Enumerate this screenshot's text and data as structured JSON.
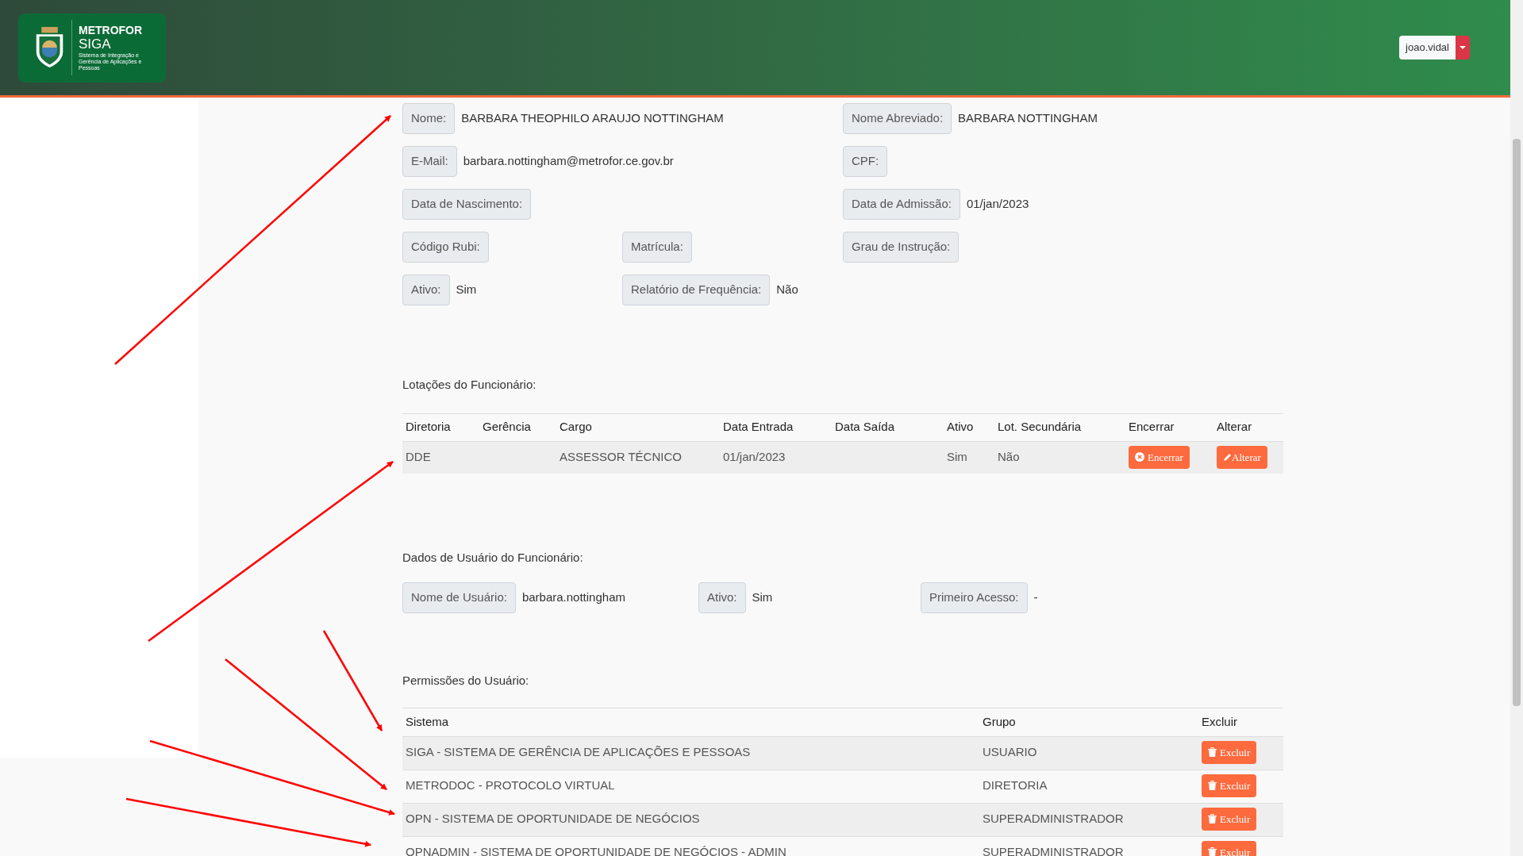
{
  "header": {
    "logo": {
      "brand": "METROFOR",
      "product": "SIGA",
      "tagline": "Sistema de Integração e Gerência de Aplicações e Pessoas"
    },
    "user": {
      "name": "joao.vidal"
    }
  },
  "employee_fields": [
    {
      "left": {
        "label": "Nome:",
        "value": "BARBARA THEOPHILO ARAUJO NOTTINGHAM"
      },
      "right": {
        "label": "Nome Abreviado:",
        "value": "BARBARA NOTTINGHAM"
      }
    },
    {
      "left": {
        "label": "E-Mail:",
        "value": "barbara.nottingham@metrofor.ce.gov.br"
      },
      "right": {
        "label": "CPF:"
      }
    },
    {
      "left": {
        "label": "Data de Nascimento:"
      },
      "right": {
        "label": "Data de Admissão:",
        "value": "01/jan/2023"
      }
    },
    {
      "left": {
        "label": "Código Rubi:"
      },
      "middle": {
        "label": "Matrícula:"
      },
      "right": {
        "label": "Grau de Instrução:"
      }
    },
    {
      "left": {
        "label": "Ativo:",
        "value": "Sim"
      },
      "middle": {
        "label": "Relatório de Frequência:",
        "value": "Não"
      }
    }
  ],
  "lotacoes": {
    "title": "Lotações do Funcionário:",
    "columns": [
      "Diretoria",
      "Gerência",
      "Cargo",
      "Data Entrada",
      "Data Saída",
      "Ativo",
      "Lot. Secundária",
      "Encerrar",
      "Alterar"
    ],
    "rows": [
      {
        "cells": [
          "DDE",
          "",
          "ASSESSOR TÉCNICO",
          "01/jan/2023",
          "",
          "Sim",
          "Não"
        ],
        "end_button": "Encerrar",
        "edit_button": "Alterar"
      }
    ]
  },
  "usuario": {
    "title": "Dados de Usuário do Funcionário:",
    "fields": [
      {
        "label": "Nome de Usuário:",
        "value": "barbara.nottingham"
      },
      {
        "label": "Ativo:",
        "value": "Sim"
      },
      {
        "label": "Primeiro Acesso:",
        "value": "-"
      }
    ]
  },
  "permissoes": {
    "title": "Permissões do Usuário:",
    "columns": [
      "Sistema",
      "Grupo",
      "Excluir"
    ],
    "rows": [
      {
        "sistema": "SIGA - SISTEMA DE GERÊNCIA DE APLICAÇÕES E PESSOAS",
        "grupo": "USUARIO",
        "button": "Excluir"
      },
      {
        "sistema": "METRODOC - PROTOCOLO VIRTUAL",
        "grupo": "DIRETORIA",
        "button": "Excluir"
      },
      {
        "sistema": "OPN - SISTEMA DE OPORTUNIDADE DE NEGÓCIOS",
        "grupo": "SUPERADMINISTRADOR",
        "button": "Excluir"
      },
      {
        "sistema": "OPNADMIN - SISTEMA DE OPORTUNIDADE DE NEGÓCIOS - ADMIN",
        "grupo": "SUPERADMINISTRADOR",
        "button": "Excluir"
      }
    ]
  }
}
